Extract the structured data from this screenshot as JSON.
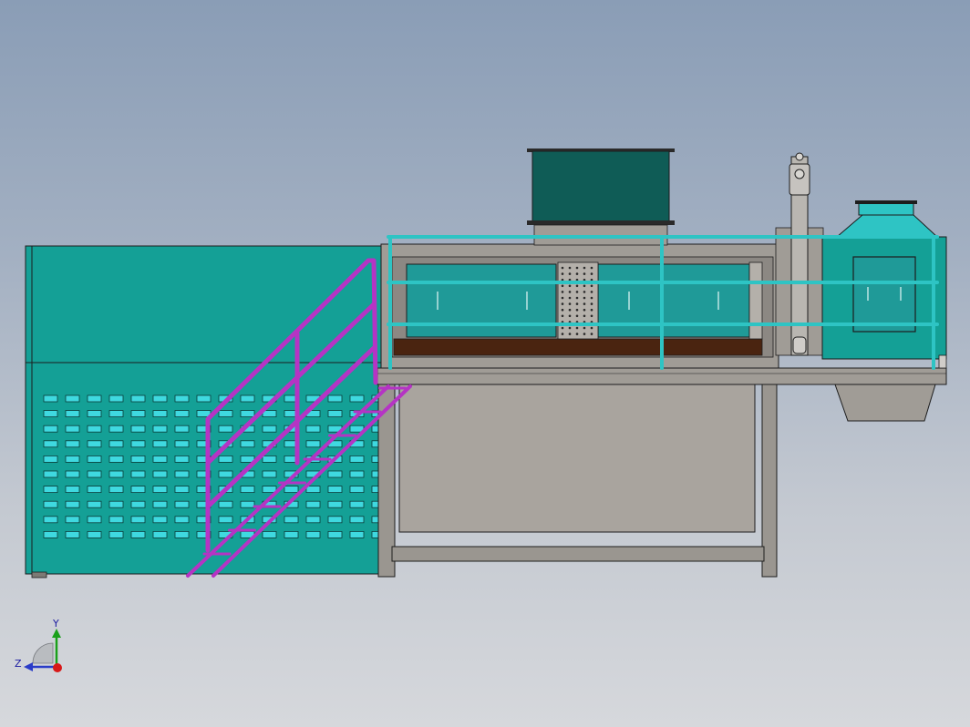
{
  "colors": {
    "teal": "#14a096",
    "teal_dark": "#0f5c56",
    "teal_light": "#2ec4c4",
    "slot": "#3fd9e0",
    "steel": "#9a9690",
    "steel_dark": "#7d7a75",
    "brown": "#4a2410",
    "magenta": "#b534c4",
    "outline": "#1d1d1d"
  },
  "icons": {
    "triad": "coordinate-triad-icon"
  },
  "triad": {
    "y_label": "Y",
    "z_label": "Z"
  }
}
